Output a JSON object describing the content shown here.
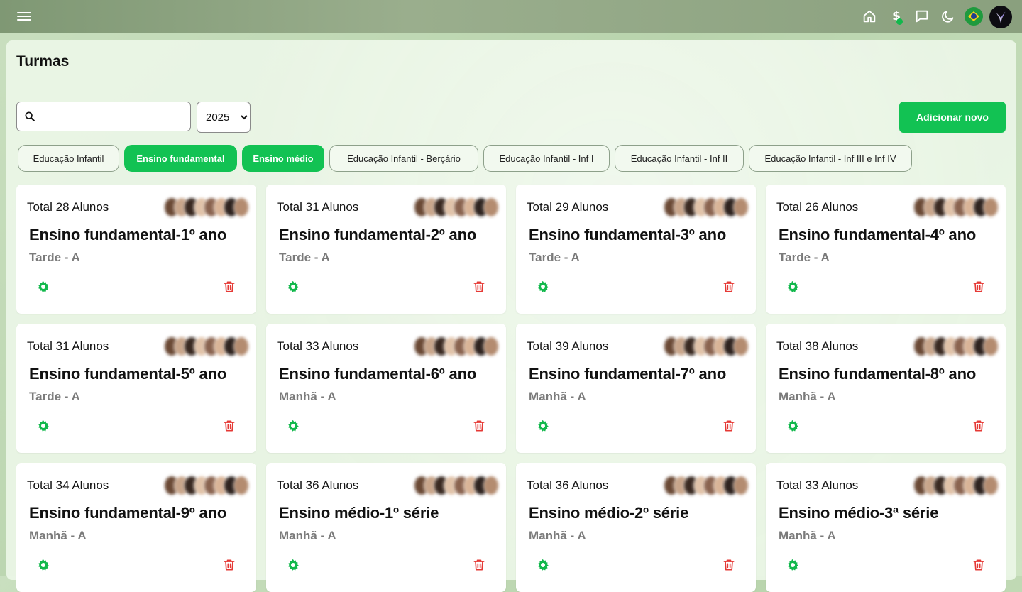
{
  "topbar": {
    "icons": [
      "menu-icon",
      "home-icon",
      "dollar-icon",
      "chat-icon",
      "moon-icon",
      "brazil-flag-icon",
      "user-avatar"
    ],
    "dollar_label": "$",
    "status_color": "#12b84c"
  },
  "page": {
    "title": "Turmas",
    "search": {
      "value": "",
      "placeholder": ""
    },
    "year": {
      "selected": "2025",
      "options": [
        "2025"
      ]
    },
    "add_button_label": "Adicionar novo"
  },
  "filters": [
    {
      "label": "Educação Infantil",
      "active": false
    },
    {
      "label": "Ensino fundamental",
      "active": true
    },
    {
      "label": "Ensino médio",
      "active": true
    },
    {
      "label": "Educação Infantil - Berçário",
      "active": false
    },
    {
      "label": "Educação Infantil - Inf I",
      "active": false
    },
    {
      "label": "Educação Infantil - Inf II",
      "active": false
    },
    {
      "label": "Educação Infantil - Inf III e Inf IV",
      "active": false
    }
  ],
  "classes": [
    {
      "total": "Total 28 Alunos",
      "name": "Ensino fundamental-1º ano",
      "shift": "Tarde - A"
    },
    {
      "total": "Total 31 Alunos",
      "name": "Ensino fundamental-2º ano",
      "shift": "Tarde - A"
    },
    {
      "total": "Total 29 Alunos",
      "name": "Ensino fundamental-3º ano",
      "shift": "Tarde - A"
    },
    {
      "total": "Total 26 Alunos",
      "name": "Ensino fundamental-4º ano",
      "shift": "Tarde - A"
    },
    {
      "total": "Total 31 Alunos",
      "name": "Ensino fundamental-5º ano",
      "shift": "Tarde - A"
    },
    {
      "total": "Total 33 Alunos",
      "name": "Ensino fundamental-6º ano",
      "shift": "Manhã - A"
    },
    {
      "total": "Total 39 Alunos",
      "name": "Ensino fundamental-7º ano",
      "shift": "Manhã - A"
    },
    {
      "total": "Total 38 Alunos",
      "name": "Ensino fundamental-8º ano",
      "shift": "Manhã - A"
    },
    {
      "total": "Total 34 Alunos",
      "name": "Ensino fundamental-9º ano",
      "shift": "Manhã - A"
    },
    {
      "total": "Total 36 Alunos",
      "name": "Ensino médio-1º série",
      "shift": "Manhã - A"
    },
    {
      "total": "Total 36 Alunos",
      "name": "Ensino médio-2º série",
      "shift": "Manhã - A"
    },
    {
      "total": "Total 33 Alunos",
      "name": "Ensino médio-3ª série",
      "shift": "Manhã - A"
    }
  ],
  "colors": {
    "accent": "#12c253",
    "gear": "#12b84c",
    "trash": "#e53935"
  }
}
